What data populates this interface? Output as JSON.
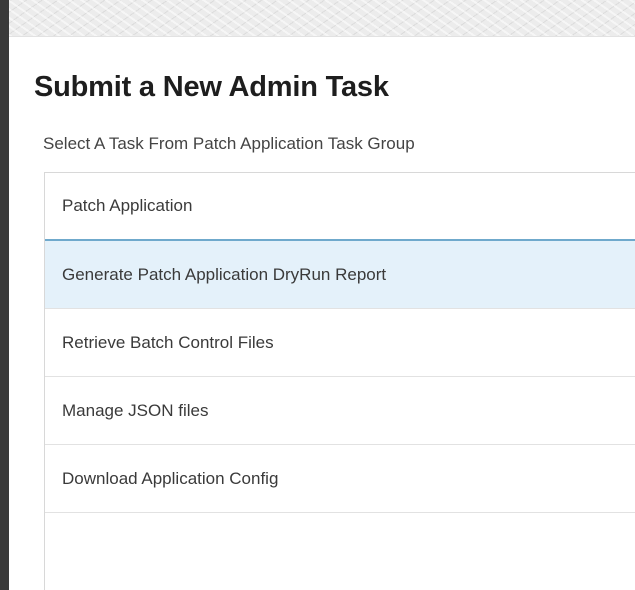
{
  "page": {
    "title": "Submit a New Admin Task",
    "subtitle": "Select A Task From Patch Application Task Group"
  },
  "task_list": {
    "items": [
      {
        "label": "Patch Application",
        "selected": false
      },
      {
        "label": "Generate Patch Application DryRun Report",
        "selected": true
      },
      {
        "label": "Retrieve Batch Control Files",
        "selected": false
      },
      {
        "label": "Manage JSON files",
        "selected": false
      },
      {
        "label": "Download Application Config",
        "selected": false
      }
    ]
  },
  "colors": {
    "selected_row_bg": "#e4f1fa",
    "focus_border": "#6fa9cc",
    "title_text": "#1e1e1e",
    "body_text": "#3a3a3a"
  }
}
